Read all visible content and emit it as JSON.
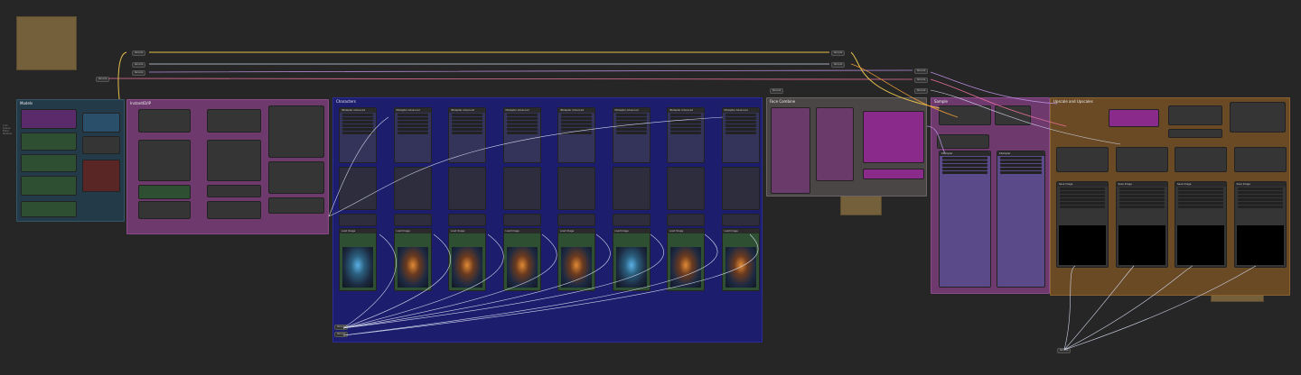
{
  "canvas": {
    "background": "#262626",
    "side_text": [
      "1.0x",
      "Queue",
      "Extra",
      "Options"
    ]
  },
  "groups": [
    {
      "key": "g1",
      "title": "Models",
      "color": "#233a48"
    },
    {
      "key": "g2",
      "title": "InstantID/IP",
      "color": "#6e3a6e"
    },
    {
      "key": "g3",
      "title": "Characters",
      "color": "#1d1d6e"
    },
    {
      "key": "g4",
      "title": "Face Combine",
      "color": "#4b4646"
    },
    {
      "key": "g5",
      "title": "Sample",
      "color": "#6e3a6e"
    },
    {
      "key": "g6",
      "title": "Upscale and Upscales",
      "color": "#6a4a25"
    }
  ],
  "nodes": {
    "char_header": "IPAdapter Advanced",
    "load_image": "Load Image",
    "save_image": "Save Image",
    "sampler": "KSampler",
    "char_count": 8
  },
  "pills": {
    "top1": "Reroute",
    "top2": "Reroute",
    "top3": "Reroute",
    "top4": "Reroute",
    "bottom": "Reroute"
  },
  "colors": {
    "link_yellow": "#e6c04a",
    "link_purple": "#b58bd8",
    "link_pink": "#e6709a",
    "link_white": "#cfd6e8",
    "link_orange": "#e89a3a",
    "note": "#74603a"
  }
}
